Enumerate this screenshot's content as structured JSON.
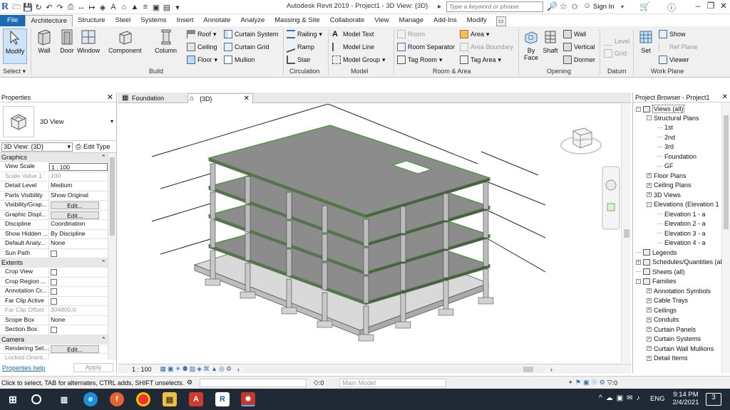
{
  "window": {
    "title": "Autodesk Revit 2019 - Project1 - 3D View: {3D}",
    "search_placeholder": "Type a keyword or phrase",
    "sign_in": "Sign In",
    "app_letter": "R"
  },
  "menu_tabs": [
    "File",
    "Architecture",
    "Structure",
    "Steel",
    "Systems",
    "Insert",
    "Annotate",
    "Analyze",
    "Massing & Site",
    "Collaborate",
    "View",
    "Manage",
    "Add-Ins",
    "Modify"
  ],
  "ribbon": {
    "modify": "Modify",
    "select": "Select",
    "build": {
      "wall": "Wall",
      "door": "Door",
      "window": "Window",
      "component": "Component",
      "column": "Column",
      "roof": "Roof",
      "ceiling": "Ceiling",
      "floor": "Floor",
      "curtain_system": "Curtain System",
      "curtain_grid": "Curtain Grid",
      "mullion": "Mullion",
      "label": "Build"
    },
    "circulation": {
      "railing": "Railing",
      "ramp": "Ramp",
      "stair": "Stair",
      "label": "Circulation"
    },
    "model": {
      "model_text": "Model Text",
      "model_line": "Model Line",
      "model_group": "Model Group",
      "label": "Model"
    },
    "room_area": {
      "room": "Room",
      "room_separator": "Room Separator",
      "tag_room": "Tag Room",
      "area": "Area",
      "area_boundary": "Area Boundary",
      "tag_area": "Tag Area",
      "label": "Room & Area"
    },
    "opening": {
      "by": "By",
      "face": "Face",
      "shaft": "Shaft",
      "wall": "Wall",
      "vertical": "Vertical",
      "dormer": "Dormer",
      "label": "Opening"
    },
    "datum": {
      "level": "Level",
      "grid": "Grid",
      "label": "Datum"
    },
    "work_plane": {
      "set": "Set",
      "show": "Show",
      "ref_plane": "Ref Plane",
      "viewer": "Viewer",
      "label": "Work Plane"
    }
  },
  "properties": {
    "title": "Properties",
    "type_name": "3D View",
    "selector": "3D View: {3D}",
    "edit_type": "Edit Type",
    "graphics_label": "Graphics",
    "graphics": [
      {
        "k": "View Scale",
        "v": "1 : 100",
        "kind": "input"
      },
      {
        "k": "Scale Value   1:",
        "v": "100",
        "kind": "dim"
      },
      {
        "k": "Detail Level",
        "v": "Medium"
      },
      {
        "k": "Parts Visibility",
        "v": "Show Original"
      },
      {
        "k": "Visibility/Grap...",
        "v": "Edit...",
        "kind": "btn"
      },
      {
        "k": "Graphic Displ...",
        "v": "Edit...",
        "kind": "btn"
      },
      {
        "k": "Discipline",
        "v": "Coordination"
      },
      {
        "k": "Show Hidden ...",
        "v": "By Discipline"
      },
      {
        "k": "Default Analy...",
        "v": "None"
      },
      {
        "k": "Sun Path",
        "v": "",
        "kind": "chk"
      }
    ],
    "extents_label": "Extents",
    "extents": [
      {
        "k": "Crop View",
        "v": "",
        "kind": "chk"
      },
      {
        "k": "Crop Region ...",
        "v": "",
        "kind": "chk"
      },
      {
        "k": "Annotation Cr...",
        "v": "",
        "kind": "chk"
      },
      {
        "k": "Far Clip Active",
        "v": "",
        "kind": "chk"
      },
      {
        "k": "Far Clip Offset",
        "v": "304800.0",
        "kind": "dim"
      },
      {
        "k": "Scope Box",
        "v": "None"
      },
      {
        "k": "Section Box",
        "v": "",
        "kind": "chk"
      }
    ],
    "camera_label": "Camera",
    "camera": [
      {
        "k": "Rendering Set...",
        "v": "Edit...",
        "kind": "btn"
      },
      {
        "k": "Locked Orient...",
        "v": "",
        "kind": "dim"
      }
    ],
    "help": "Properties help",
    "apply": "Apply"
  },
  "view_tabs": [
    {
      "label": "Foundation"
    },
    {
      "label": "{3D}"
    }
  ],
  "viewcube": {
    "front": "FRONT",
    "right": "RIGHT"
  },
  "browser": {
    "title": "Project Browser - Project1",
    "items": [
      {
        "label": "Views (all)",
        "lvl": 0,
        "exp": "-",
        "icon": true
      },
      {
        "label": "Structural Plans",
        "lvl": 1,
        "exp": "-"
      },
      {
        "label": "1st",
        "lvl": 2
      },
      {
        "label": "2nd",
        "lvl": 2
      },
      {
        "label": "3rd",
        "lvl": 2
      },
      {
        "label": "Foundation",
        "lvl": 2
      },
      {
        "label": "GF",
        "lvl": 2
      },
      {
        "label": "Floor Plans",
        "lvl": 1,
        "exp": "+"
      },
      {
        "label": "Ceiling Plans",
        "lvl": 1,
        "exp": "+"
      },
      {
        "label": "3D Views",
        "lvl": 1,
        "exp": "+"
      },
      {
        "label": "Elevations (Elevation 1",
        "lvl": 1,
        "exp": "-"
      },
      {
        "label": "Elevation 1 - a",
        "lvl": 2
      },
      {
        "label": "Elevation 2 - a",
        "lvl": 2
      },
      {
        "label": "Elevation 3 - a",
        "lvl": 2
      },
      {
        "label": "Elevation 4 - a",
        "lvl": 2
      },
      {
        "label": "Legends",
        "lvl": 0,
        "icon": true
      },
      {
        "label": "Schedules/Quantities (al",
        "lvl": 0,
        "exp": "+",
        "icon": true
      },
      {
        "label": "Sheets (all)",
        "lvl": 0,
        "icon": true
      },
      {
        "label": "Families",
        "lvl": 0,
        "exp": "-",
        "icon": true
      },
      {
        "label": "Annotation Symbols",
        "lvl": 1,
        "exp": "+"
      },
      {
        "label": "Cable Trays",
        "lvl": 1,
        "exp": "+"
      },
      {
        "label": "Ceilings",
        "lvl": 1,
        "exp": "+"
      },
      {
        "label": "Conduits",
        "lvl": 1,
        "exp": "+"
      },
      {
        "label": "Curtain Panels",
        "lvl": 1,
        "exp": "+"
      },
      {
        "label": "Curtain Systems",
        "lvl": 1,
        "exp": "+"
      },
      {
        "label": "Curtain Wall Mullions",
        "lvl": 1,
        "exp": "+"
      },
      {
        "label": "Detail Items",
        "lvl": 1,
        "exp": "+"
      }
    ]
  },
  "view_bar": {
    "scale": "1 : 100"
  },
  "status": {
    "message": "Click to select, TAB for alternates, CTRL adds, SHIFT unselects.",
    "count": ":0",
    "model": "Main Model",
    "filter_count": ":0"
  },
  "taskbar": {
    "time": "9:14 PM",
    "date": "2/4/2021",
    "lang": "ENG",
    "notif": "3"
  }
}
